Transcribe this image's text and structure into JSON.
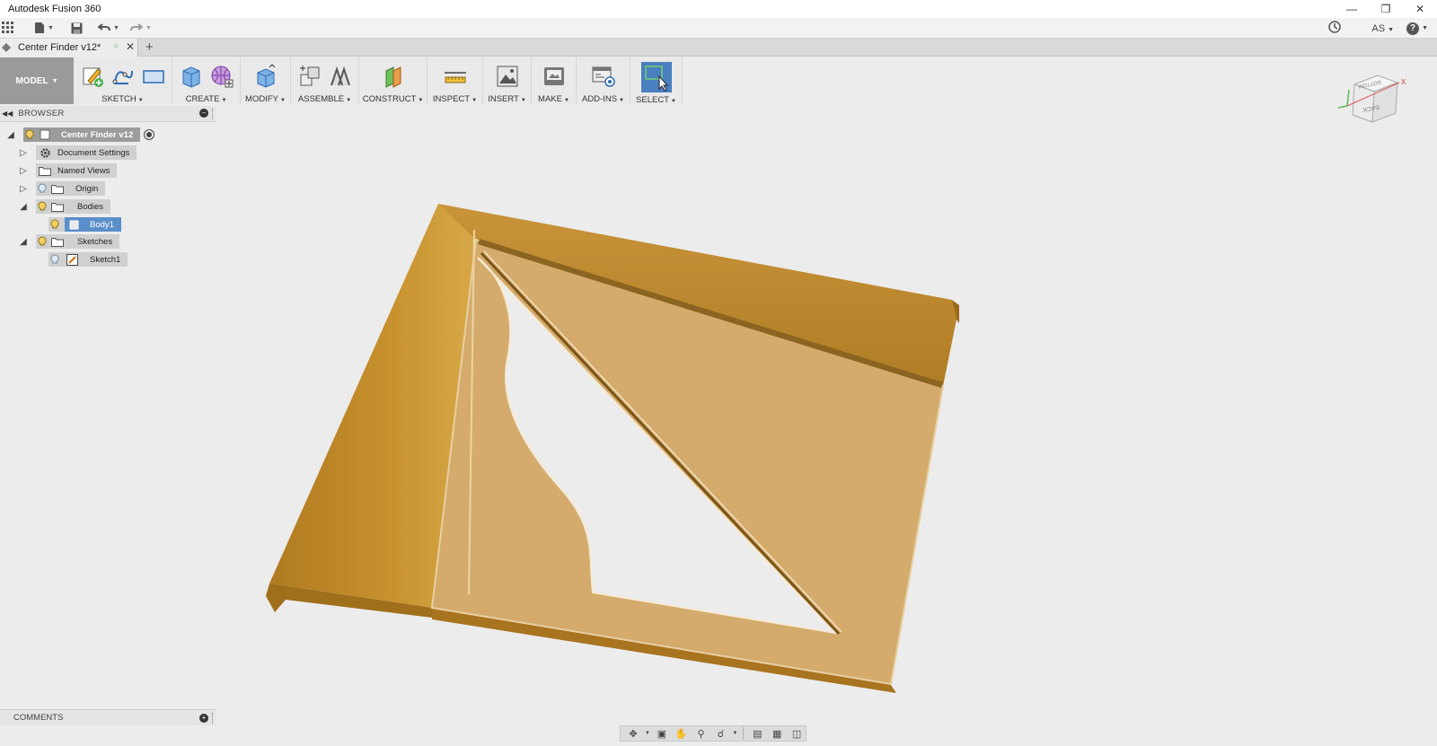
{
  "window": {
    "title": "Autodesk Fusion 360",
    "controls": [
      "minimize-icon",
      "restore-icon",
      "close-icon"
    ]
  },
  "appbar": {
    "user": "AS",
    "help": "?"
  },
  "tab": {
    "label": "Center Finder v12*",
    "add": "+"
  },
  "ribbon": {
    "model_label": "MODEL",
    "groups": [
      {
        "label": "SKETCH",
        "icons": [
          "create-sketch-icon",
          "spline-icon",
          "rectangle-icon"
        ]
      },
      {
        "label": "CREATE",
        "icons": [
          "extrude-box-icon",
          "form-sphere-icon"
        ]
      },
      {
        "label": "MODIFY",
        "icons": [
          "press-pull-icon"
        ]
      },
      {
        "label": "ASSEMBLE",
        "icons": [
          "new-component-icon",
          "joint-icon"
        ]
      },
      {
        "label": "CONSTRUCT",
        "icons": [
          "offset-plane-icon"
        ]
      },
      {
        "label": "INSPECT",
        "icons": [
          "measure-icon"
        ]
      },
      {
        "label": "INSERT",
        "icons": [
          "insert-image-icon"
        ]
      },
      {
        "label": "MAKE",
        "icons": [
          "3d-print-icon"
        ]
      },
      {
        "label": "ADD-INS",
        "icons": [
          "scripts-addins-icon"
        ]
      },
      {
        "label": "SELECT",
        "icons": [
          "select-cursor-icon"
        ]
      }
    ]
  },
  "browser": {
    "label": "BROWSER",
    "root": "Center Finder v12",
    "items": [
      {
        "label": "Document Settings"
      },
      {
        "label": "Named Views"
      },
      {
        "label": "Origin"
      },
      {
        "label": "Bodies"
      },
      {
        "label": "Body1"
      },
      {
        "label": "Sketches"
      },
      {
        "label": "Sketch1"
      }
    ]
  },
  "comments": {
    "label": "COMMENTS"
  },
  "viewcube": {
    "faces": [
      "BOTTOM",
      "BACK"
    ],
    "axis_x": "X"
  },
  "colors": {
    "body_gold": "#c08a2e",
    "body_light": "#d9b070",
    "selected_blue": "#5b8fc9",
    "ribbon_bg": "#e9e9e9"
  }
}
